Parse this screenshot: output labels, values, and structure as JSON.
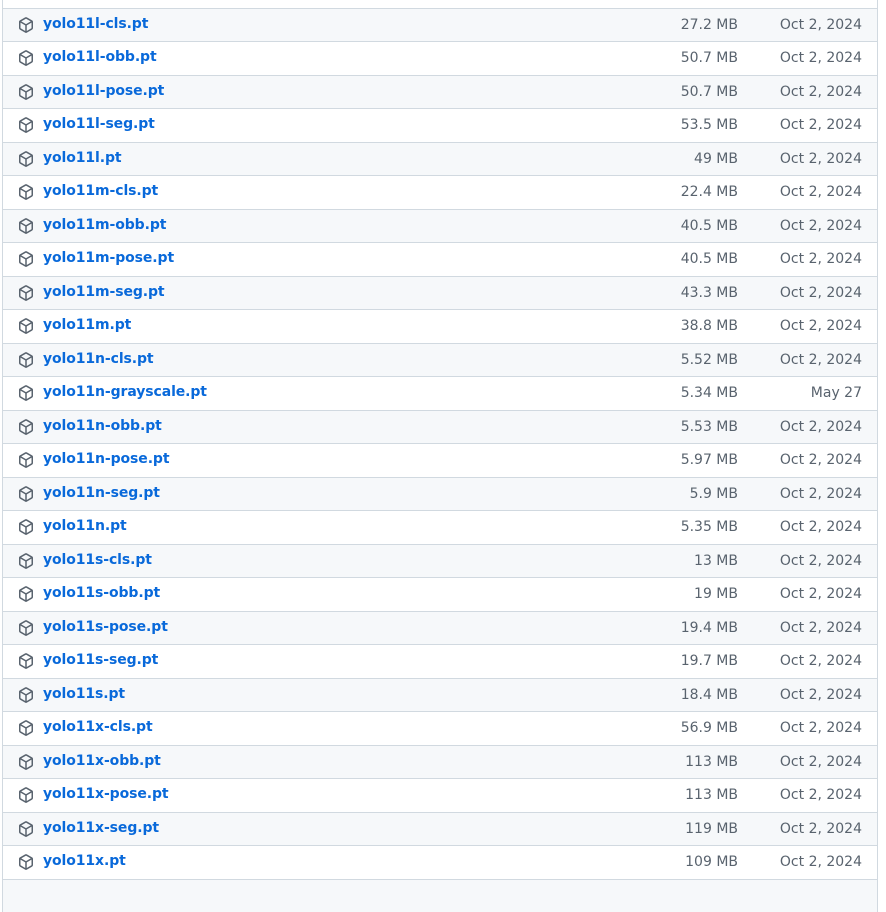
{
  "assets": [
    {
      "name": "",
      "size": "",
      "date": ""
    },
    {
      "name": "yolo11l-cls.pt",
      "size": "27.2 MB",
      "date": "Oct 2, 2024"
    },
    {
      "name": "yolo11l-obb.pt",
      "size": "50.7 MB",
      "date": "Oct 2, 2024"
    },
    {
      "name": "yolo11l-pose.pt",
      "size": "50.7 MB",
      "date": "Oct 2, 2024"
    },
    {
      "name": "yolo11l-seg.pt",
      "size": "53.5 MB",
      "date": "Oct 2, 2024"
    },
    {
      "name": "yolo11l.pt",
      "size": "49 MB",
      "date": "Oct 2, 2024"
    },
    {
      "name": "yolo11m-cls.pt",
      "size": "22.4 MB",
      "date": "Oct 2, 2024"
    },
    {
      "name": "yolo11m-obb.pt",
      "size": "40.5 MB",
      "date": "Oct 2, 2024"
    },
    {
      "name": "yolo11m-pose.pt",
      "size": "40.5 MB",
      "date": "Oct 2, 2024"
    },
    {
      "name": "yolo11m-seg.pt",
      "size": "43.3 MB",
      "date": "Oct 2, 2024"
    },
    {
      "name": "yolo11m.pt",
      "size": "38.8 MB",
      "date": "Oct 2, 2024"
    },
    {
      "name": "yolo11n-cls.pt",
      "size": "5.52 MB",
      "date": "Oct 2, 2024"
    },
    {
      "name": "yolo11n-grayscale.pt",
      "size": "5.34 MB",
      "date": "May 27"
    },
    {
      "name": "yolo11n-obb.pt",
      "size": "5.53 MB",
      "date": "Oct 2, 2024"
    },
    {
      "name": "yolo11n-pose.pt",
      "size": "5.97 MB",
      "date": "Oct 2, 2024"
    },
    {
      "name": "yolo11n-seg.pt",
      "size": "5.9 MB",
      "date": "Oct 2, 2024"
    },
    {
      "name": "yolo11n.pt",
      "size": "5.35 MB",
      "date": "Oct 2, 2024"
    },
    {
      "name": "yolo11s-cls.pt",
      "size": "13 MB",
      "date": "Oct 2, 2024"
    },
    {
      "name": "yolo11s-obb.pt",
      "size": "19 MB",
      "date": "Oct 2, 2024"
    },
    {
      "name": "yolo11s-pose.pt",
      "size": "19.4 MB",
      "date": "Oct 2, 2024"
    },
    {
      "name": "yolo11s-seg.pt",
      "size": "19.7 MB",
      "date": "Oct 2, 2024"
    },
    {
      "name": "yolo11s.pt",
      "size": "18.4 MB",
      "date": "Oct 2, 2024"
    },
    {
      "name": "yolo11x-cls.pt",
      "size": "56.9 MB",
      "date": "Oct 2, 2024"
    },
    {
      "name": "yolo11x-obb.pt",
      "size": "113 MB",
      "date": "Oct 2, 2024"
    },
    {
      "name": "yolo11x-pose.pt",
      "size": "113 MB",
      "date": "Oct 2, 2024"
    },
    {
      "name": "yolo11x-seg.pt",
      "size": "119 MB",
      "date": "Oct 2, 2024"
    },
    {
      "name": "yolo11x.pt",
      "size": "109 MB",
      "date": "Oct 2, 2024"
    },
    {
      "name": "",
      "size": "",
      "date": ""
    }
  ],
  "colors": {
    "link": "#0969da",
    "muted": "#59636e",
    "border": "#d1d9e0",
    "row_alt": "#f6f8fa"
  },
  "icon": "package-icon"
}
